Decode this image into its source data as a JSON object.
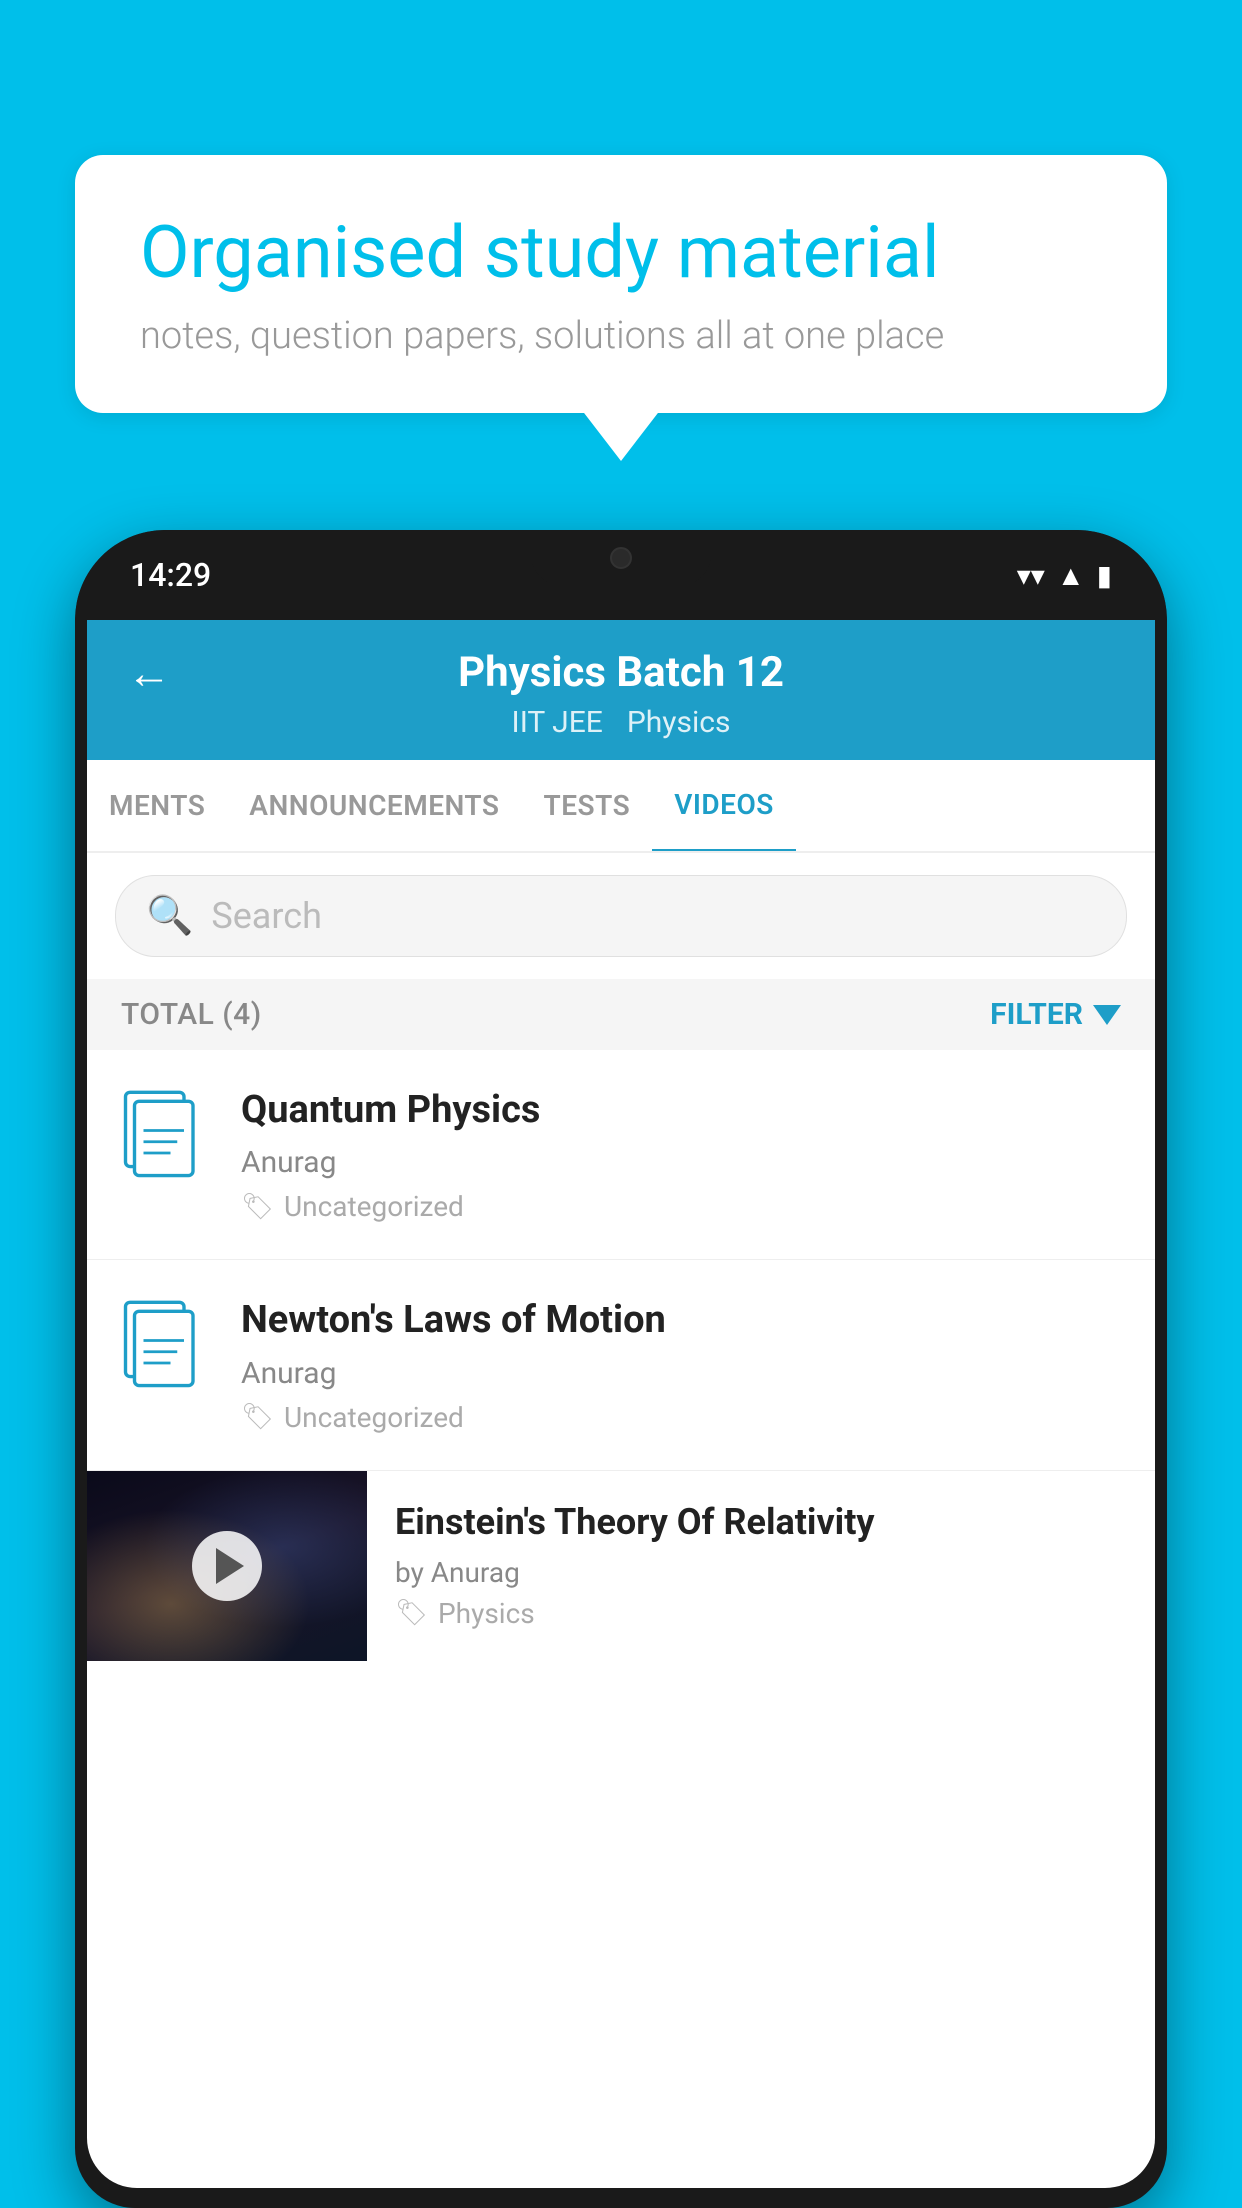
{
  "background": {
    "color": "#00BFEA"
  },
  "bubble": {
    "title": "Organised study material",
    "subtitle": "notes, question papers, solutions all at one place"
  },
  "status_bar": {
    "time": "14:29",
    "icons": [
      "wifi",
      "signal",
      "battery"
    ]
  },
  "app_header": {
    "title": "Physics Batch 12",
    "tags": [
      "IIT JEE",
      "Physics"
    ],
    "back_label": "←"
  },
  "tabs": [
    {
      "label": "MENTS",
      "active": false
    },
    {
      "label": "ANNOUNCEMENTS",
      "active": false
    },
    {
      "label": "TESTS",
      "active": false
    },
    {
      "label": "VIDEOS",
      "active": true
    }
  ],
  "search": {
    "placeholder": "Search"
  },
  "filter": {
    "total_label": "TOTAL (4)",
    "filter_label": "FILTER"
  },
  "videos": [
    {
      "title": "Quantum Physics",
      "author": "Anurag",
      "tag": "Uncategorized",
      "has_thumbnail": false
    },
    {
      "title": "Newton's Laws of Motion",
      "author": "Anurag",
      "tag": "Uncategorized",
      "has_thumbnail": false
    },
    {
      "title": "Einstein's Theory Of Relativity",
      "author": "by Anurag",
      "tag": "Physics",
      "has_thumbnail": true
    }
  ]
}
